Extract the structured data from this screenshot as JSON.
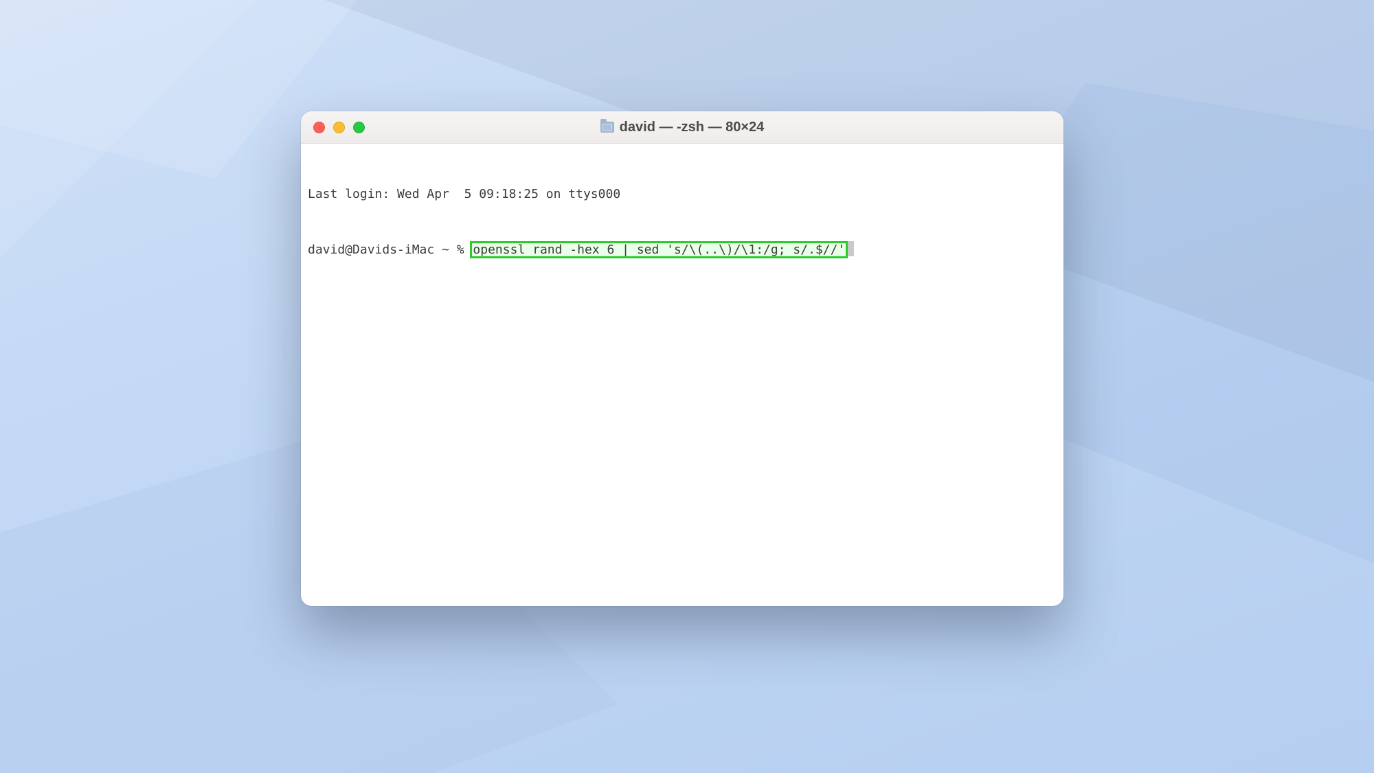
{
  "window": {
    "title": "david — -zsh — 80×24"
  },
  "terminal": {
    "last_login": "Last login: Wed Apr  5 09:18:25 on ttys000",
    "prompt": "david@Davids-iMac ~ % ",
    "command": "openssl rand -hex 6 | sed 's/\\(..\\)/\\1:/g; s/.$//'"
  },
  "annotation": {
    "highlight_color": "#2acb2a"
  }
}
